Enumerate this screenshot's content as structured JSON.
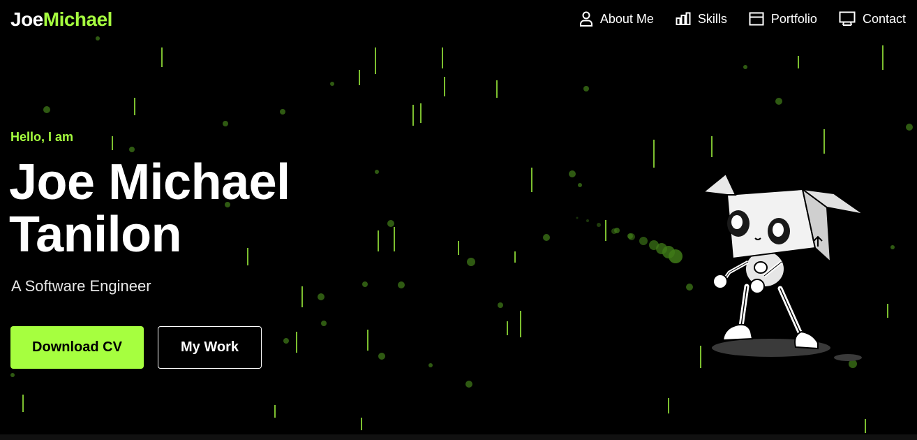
{
  "header": {
    "logo_first": "Joe",
    "logo_second": "Michael",
    "nav": [
      {
        "label": "About Me",
        "icon": "user-icon"
      },
      {
        "label": "Skills",
        "icon": "bar-chart-icon"
      },
      {
        "label": "Portfolio",
        "icon": "window-icon"
      },
      {
        "label": "Contact",
        "icon": "monitor-icon"
      }
    ]
  },
  "hero": {
    "greeting": "Hello, I am",
    "name_line1": "Joe Michael",
    "name_line2": "Tanilon",
    "role": "A Software Engineer",
    "primary_button": "Download CV",
    "secondary_button": "My Work"
  },
  "colors": {
    "accent": "#a6ff3f",
    "background": "#000000",
    "text": "#ffffff"
  }
}
